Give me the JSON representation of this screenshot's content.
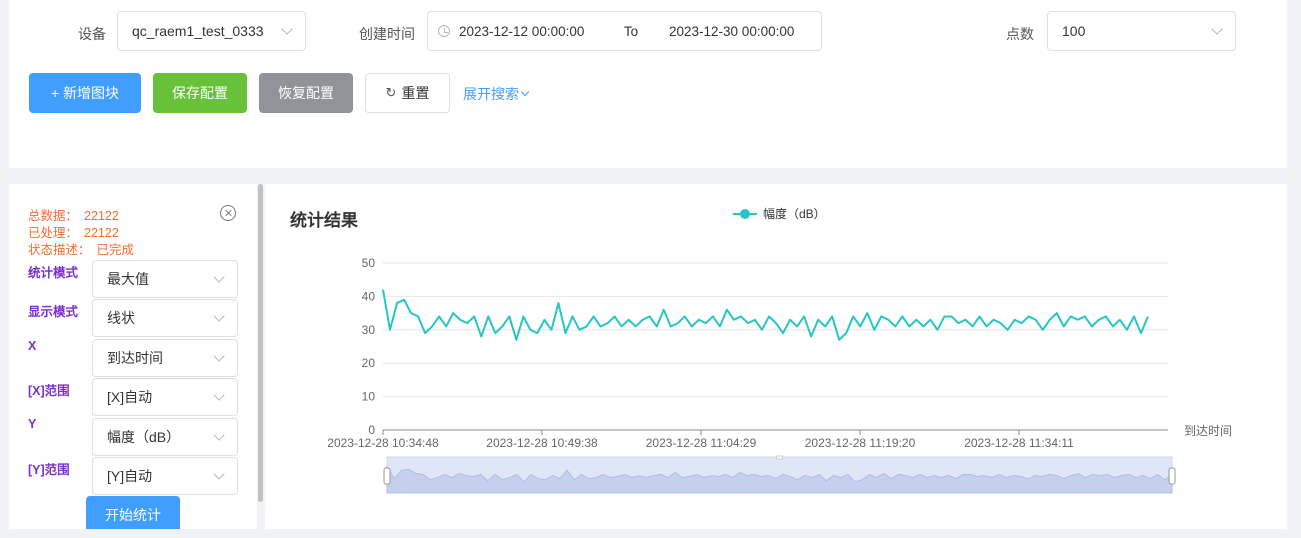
{
  "filters": {
    "device_label": "设备",
    "device_value": "qc_raem1_test_0333",
    "created_label": "创建时间",
    "date_start": "2023-12-12 00:00:00",
    "date_sep": "To",
    "date_end": "2023-12-30 00:00:00",
    "points_label": "点数",
    "points_value": "100"
  },
  "toolbar": {
    "add_block": "+ 新增图块",
    "save_config": "保存配置",
    "restore_config": "恢复配置",
    "reset": "重置",
    "expand_search": "展开搜索"
  },
  "stats": {
    "total_label": "总数据：",
    "total_value": "22122",
    "processed_label": "已处理：",
    "processed_value": "22122",
    "status_label": "状态描述：",
    "status_value": "已完成"
  },
  "params": {
    "stat_mode_label": "统计模式",
    "stat_mode_value": "最大值",
    "display_mode_label": "显示模式",
    "display_mode_value": "线状",
    "x_label": "X",
    "x_value": "到达时间",
    "x_range_label": "[X]范围",
    "x_range_value": "[X]自动",
    "y_label": "Y",
    "y_value": "幅度（dB）",
    "y_range_label": "[Y]范围",
    "y_range_value": "[Y]自动",
    "start_button": "开始统计"
  },
  "colors": {
    "series": "#26c6c6",
    "primary": "#409eff",
    "success": "#67c23a",
    "info": "#909399",
    "stat_text": "#f56c2d",
    "param_label": "#7b2fd0"
  },
  "chart_data": {
    "type": "line",
    "title": "统计结果",
    "xlabel": "到达时间",
    "ylabel": "",
    "ylim": [
      0,
      50
    ],
    "yticks": [
      0,
      10,
      20,
      30,
      40,
      50
    ],
    "xtick_labels": [
      "2023-12-28 10:34:48",
      "2023-12-28 10:49:38",
      "2023-12-28 11:04:29",
      "2023-12-28 11:19:20",
      "2023-12-28 11:34:11"
    ],
    "series": [
      {
        "name": "幅度（dB）",
        "values": [
          42,
          30,
          38,
          39,
          35,
          34,
          29,
          31,
          34,
          31,
          35,
          33,
          32,
          34,
          28,
          34,
          29,
          31,
          34,
          27,
          34,
          30,
          29,
          33,
          30,
          38,
          29,
          34,
          30,
          31,
          34,
          31,
          32,
          34,
          31,
          33,
          31,
          33,
          34,
          31,
          36,
          31,
          32,
          34,
          31,
          33,
          32,
          34,
          31,
          36,
          33,
          34,
          32,
          33,
          30,
          34,
          32,
          29,
          33,
          31,
          34,
          28,
          33,
          31,
          34,
          27,
          29,
          34,
          31,
          35,
          30,
          34,
          33,
          31,
          34,
          31,
          33,
          31,
          33,
          30,
          34,
          34,
          32,
          33,
          31,
          34,
          31,
          33,
          32,
          30,
          33,
          32,
          34,
          33,
          30,
          33,
          35,
          31,
          34,
          33,
          34,
          31,
          33,
          34,
          31,
          33,
          30,
          34,
          29,
          34
        ]
      }
    ],
    "grid": true,
    "legend_position": "top-center",
    "data_zoom": true
  }
}
